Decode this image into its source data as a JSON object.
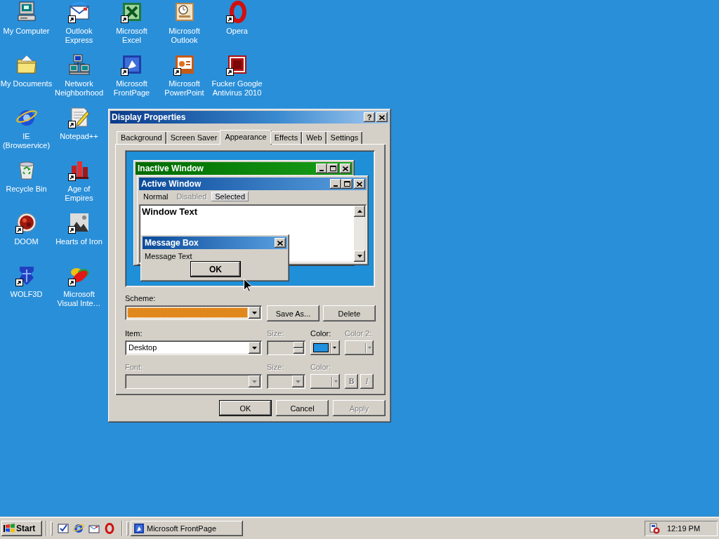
{
  "desktop": {
    "icon_rows": [
      [
        {
          "label": "My Computer",
          "shortcut": false
        },
        {
          "label": "Outlook\nExpress",
          "shortcut": true
        },
        {
          "label": "Microsoft\nExcel",
          "shortcut": true
        },
        {
          "label": "Microsoft\nOutlook",
          "shortcut": false
        },
        {
          "label": "Opera",
          "shortcut": true
        }
      ],
      [
        {
          "label": "My Documents",
          "shortcut": false
        },
        {
          "label": "Network\nNeighborhood",
          "shortcut": false
        },
        {
          "label": "Microsoft\nFrontPage",
          "shortcut": true
        },
        {
          "label": "Microsoft\nPowerPoint",
          "shortcut": true
        },
        {
          "label": "Fucker Google\nAntivirus 2010",
          "shortcut": true
        }
      ],
      [
        {
          "label": "IE\n(Browservice)",
          "shortcut": false
        },
        {
          "label": "Notepad++",
          "shortcut": true
        }
      ],
      [
        {
          "label": "Recycle Bin",
          "shortcut": false
        },
        {
          "label": "Age of\nEmpires",
          "shortcut": true
        }
      ],
      [
        {
          "label": "DOOM",
          "shortcut": true
        },
        {
          "label": "Hearts of Iron",
          "shortcut": true
        }
      ],
      [
        {
          "label": "WOLF3D",
          "shortcut": true
        },
        {
          "label": "Microsoft\nVisual Inte…",
          "shortcut": true
        }
      ]
    ]
  },
  "dialog": {
    "title": "Display Properties",
    "help_button": "?",
    "tabs": [
      {
        "label": "Background",
        "selected": false
      },
      {
        "label": "Screen Saver",
        "selected": false
      },
      {
        "label": "Appearance",
        "selected": true
      },
      {
        "label": "Effects",
        "selected": false
      },
      {
        "label": "Web",
        "selected": false
      },
      {
        "label": "Settings",
        "selected": false
      }
    ],
    "preview": {
      "inactive_window": {
        "title": "Inactive Window"
      },
      "active_window": {
        "title": "Active Window",
        "menu": [
          {
            "label": "Normal",
            "disabled": false,
            "selected": false
          },
          {
            "label": "Disabled",
            "disabled": true,
            "selected": false
          },
          {
            "label": "Selected",
            "disabled": false,
            "selected": true
          }
        ],
        "text": "Window Text"
      },
      "message_box": {
        "title": "Message Box",
        "text": "Message Text",
        "button": "OK"
      }
    },
    "scheme": {
      "label": "Scheme:"
    },
    "scheme_buttons": [
      {
        "label": "Save As...",
        "disabled": false
      },
      {
        "label": "Delete",
        "disabled": false
      }
    ],
    "item": {
      "label": "Item:",
      "value": "Desktop"
    },
    "item_size": {
      "label": "Size:",
      "disabled": true
    },
    "item_color": {
      "label": "Color:",
      "disabled": false,
      "color": "#2090e0"
    },
    "item_color2": {
      "label": "Color 2:",
      "disabled": true
    },
    "font": {
      "label": "Font:",
      "disabled": true
    },
    "font_size": {
      "label": "Size:",
      "disabled": true
    },
    "font_color": {
      "label": "Color:",
      "disabled": true
    },
    "style_buttons": [
      {
        "label": "B",
        "kind": "bold",
        "disabled": true
      },
      {
        "label": "I",
        "kind": "italic",
        "disabled": true
      }
    ],
    "buttons": [
      {
        "label": "OK",
        "default": true,
        "disabled": false
      },
      {
        "label": "Cancel",
        "default": false,
        "disabled": false
      },
      {
        "label": "Apply",
        "default": false,
        "disabled": true
      }
    ]
  },
  "taskbar": {
    "start_button": "Start",
    "tasks": [
      {
        "label": "Microsoft FrontPage",
        "selected": false
      }
    ],
    "clock": "12:19 PM"
  }
}
